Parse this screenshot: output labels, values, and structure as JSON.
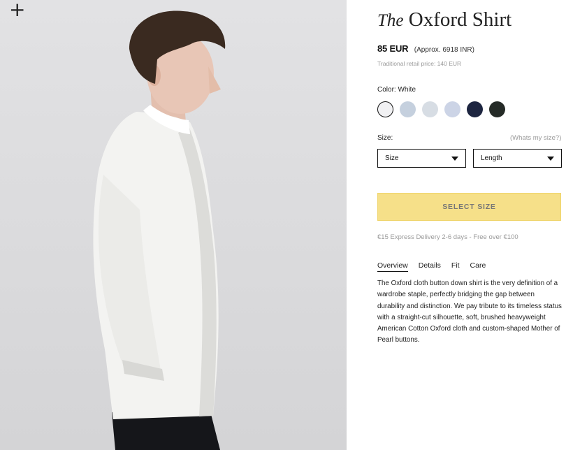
{
  "product": {
    "title_prefix": "The",
    "title_name": "Oxford Shirt",
    "price": "85 EUR",
    "approx_price": "(Approx. 6918 INR)",
    "retail_price": "Traditional retail price: 140 EUR"
  },
  "color": {
    "label": "Color: White",
    "swatches": [
      {
        "name": "White",
        "hex": "#f1f1f3",
        "selected": true
      },
      {
        "name": "Light Blue",
        "hex": "#c5d0de",
        "selected": false
      },
      {
        "name": "Pale Blue",
        "hex": "#d7dde4",
        "selected": false
      },
      {
        "name": "Blue Stripe",
        "hex": "#ccd4e6",
        "selected": false
      },
      {
        "name": "Navy",
        "hex": "#1d2540",
        "selected": false
      },
      {
        "name": "Dark Green",
        "hex": "#252b27",
        "selected": false
      }
    ]
  },
  "size": {
    "label": "Size:",
    "guide_link": "(Whats my size?)",
    "size_select": "Size",
    "length_select": "Length"
  },
  "cta": {
    "label": "SELECT SIZE",
    "color": "#f6e089"
  },
  "delivery": "€15 Express Delivery 2-6 days - Free over €100",
  "tabs": [
    {
      "label": "Overview",
      "active": true
    },
    {
      "label": "Details",
      "active": false
    },
    {
      "label": "Fit",
      "active": false
    },
    {
      "label": "Care",
      "active": false
    }
  ],
  "description": "The Oxford cloth button down shirt is the very definition of a wardrobe staple, perfectly bridging the gap between durability and distinction. We pay tribute to its timeless status with a straight-cut silhouette, soft, brushed heavyweight American Cotton Oxford cloth and custom-shaped Mother of Pearl buttons.",
  "gallery": {
    "zoom_icon": "plus-icon",
    "image": "model-wearing-white-oxford-shirt"
  }
}
